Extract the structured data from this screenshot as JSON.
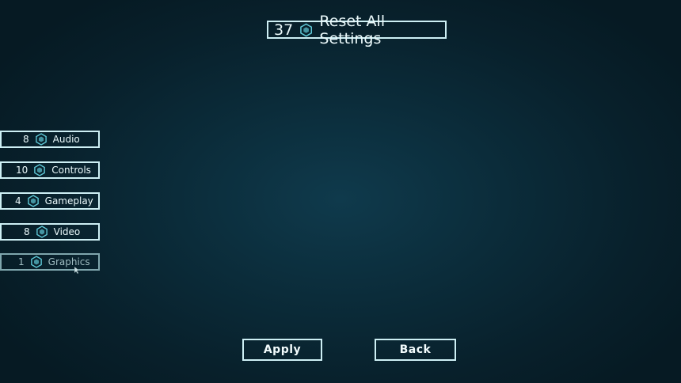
{
  "reset": {
    "count": "37",
    "label": "Reset All Settings",
    "icon": "hexagon-icon"
  },
  "categories": [
    {
      "count": "8",
      "label": "Audio"
    },
    {
      "count": "10",
      "label": "Controls"
    },
    {
      "count": "4",
      "label": "Gameplay"
    },
    {
      "count": "8",
      "label": "Video"
    },
    {
      "count": "1",
      "label": "Graphics"
    }
  ],
  "buttons": {
    "apply": "Apply",
    "back": "Back"
  },
  "colors": {
    "border": "#cdeff4",
    "accent": "#5fc8d6",
    "background": "#0b2c3a"
  }
}
